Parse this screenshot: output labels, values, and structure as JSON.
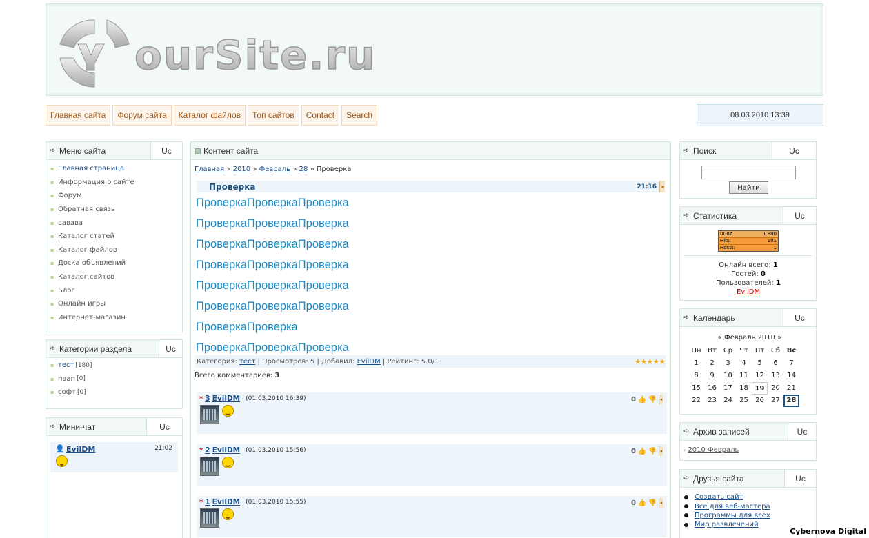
{
  "header": {
    "logo_text": "YOURSITE.RU"
  },
  "nav": {
    "items": [
      "Главная сайта",
      "Форум сайта",
      "Каталог файлов",
      "Топ сайтов",
      "Contact",
      "Search"
    ],
    "datetime": "08.03.2010 13:39"
  },
  "left": {
    "menu": {
      "title": "Меню сайта",
      "uc": "Uc",
      "items": [
        "Главная страница",
        "Информация о сайте",
        "Форум",
        "Обратная связь",
        "вавава",
        "Каталог статей",
        "Каталог файлов",
        "Доска объявлений",
        "Каталог сайтов",
        "Блог",
        "Онлайн игры",
        "Интернет-магазин"
      ]
    },
    "categories": {
      "title": "Категории раздела",
      "uc": "Uc",
      "items": [
        {
          "name": "тест",
          "count": "[180]"
        },
        {
          "name": "пвап",
          "count": "[0]"
        },
        {
          "name": "софт",
          "count": "[0]"
        }
      ]
    },
    "chat": {
      "title": "Мини-чат",
      "uc": "Uc",
      "user": "EvilDM",
      "time": "21:02"
    }
  },
  "center": {
    "title": "Контент сайта",
    "breadcrumb": {
      "home": "Главная",
      "year": "2010",
      "month": "Февраль",
      "day": "28",
      "current": "Проверка",
      "sep": "»"
    },
    "entry": {
      "title": "Проверка",
      "time": "21:16",
      "lines": [
        "ПроверкаПроверкаПроверка",
        "ПроверкаПроверкаПроверка",
        "ПроверкаПроверкаПроверка",
        "ПроверкаПроверкаПроверка",
        "ПроверкаПроверкаПроверка",
        "ПроверкаПроверкаПроверка",
        "ПроверкаПроверка",
        "ПроверкаПроверкаПроверка"
      ],
      "meta": {
        "cat_label": "Категория:",
        "cat": "тест",
        "views": "| Просмотров: 5 | Добавил:",
        "author": "EvilDM",
        "rating": "| Рейтинг: 5.0/1"
      },
      "stars": "★★★★★",
      "rating_value": 5.0
    },
    "total_label": "Всего комментариев:",
    "total_value": "3",
    "comments": [
      {
        "num": "3",
        "name": "EvilDM",
        "date": "(01.03.2010 16:39)",
        "score": "0"
      },
      {
        "num": "2",
        "name": "EvilDM",
        "date": "(01.03.2010 15:56)",
        "score": "0"
      },
      {
        "num": "1",
        "name": "EvilDM",
        "date": "(01.03.2010 15:55)",
        "score": "0"
      }
    ]
  },
  "right": {
    "search": {
      "title": "Поиск",
      "uc": "Uc",
      "button": "Найти",
      "value": ""
    },
    "stats": {
      "title": "Статистика",
      "uc": "Uc",
      "counter": {
        "brand": "uCoz",
        "total": "1 800",
        "hits_label": "Hits:",
        "hits": "101",
        "hosts_label": "Hosts:",
        "hosts": "1"
      },
      "online_label": "Онлайн всего:",
      "online": "1",
      "guests_label": "Гостей:",
      "guests": "0",
      "users_label": "Пользователей:",
      "users": "1",
      "user": "EvilDM"
    },
    "calendar": {
      "title": "Календарь",
      "uc": "Uc",
      "month": "« Февраль 2010 »",
      "days": [
        "Пн",
        "Вт",
        "Ср",
        "Чт",
        "Пт",
        "Сб",
        "Вс"
      ],
      "weeks": [
        [
          "1",
          "2",
          "3",
          "4",
          "5",
          "6",
          "7"
        ],
        [
          "8",
          "9",
          "10",
          "11",
          "12",
          "13",
          "14"
        ],
        [
          "15",
          "16",
          "17",
          "18",
          "19",
          "20",
          "21"
        ],
        [
          "22",
          "23",
          "24",
          "25",
          "26",
          "27",
          "28"
        ]
      ]
    },
    "archive": {
      "title": "Архив записей",
      "uc": "Uc",
      "item": "2010 Февраль"
    },
    "friends": {
      "title": "Друзья сайта",
      "uc": "Uc",
      "items": [
        "Создать сайт",
        "Все для веб-мастера",
        "Программы для всех",
        "Мир развлечений"
      ]
    }
  },
  "watermark": "Cybernova Digital"
}
